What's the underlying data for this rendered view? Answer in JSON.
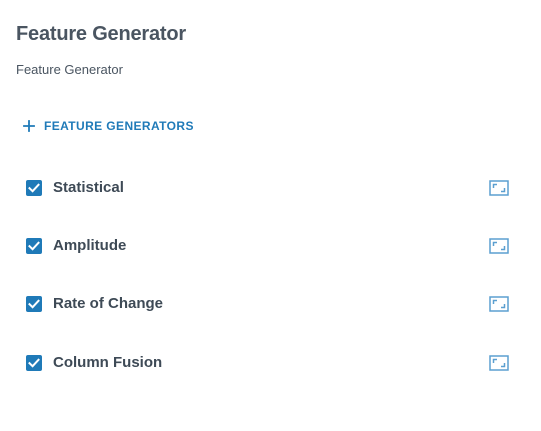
{
  "header": {
    "title": "Feature Generator",
    "subtitle": "Feature Generator"
  },
  "actions": {
    "add_label": "FEATURE GENERATORS",
    "add_icon": "plus-icon"
  },
  "generators": [
    {
      "label": "Statistical",
      "checked": true,
      "expand_icon": "expand-icon"
    },
    {
      "label": "Amplitude",
      "checked": true,
      "expand_icon": "expand-icon"
    },
    {
      "label": "Rate of Change",
      "checked": true,
      "expand_icon": "expand-icon"
    },
    {
      "label": "Column Fusion",
      "checked": true,
      "expand_icon": "expand-icon"
    }
  ],
  "colors": {
    "accent": "#1f7ab8",
    "text": "#3e4a56",
    "icon_muted": "#5b9fd0"
  }
}
